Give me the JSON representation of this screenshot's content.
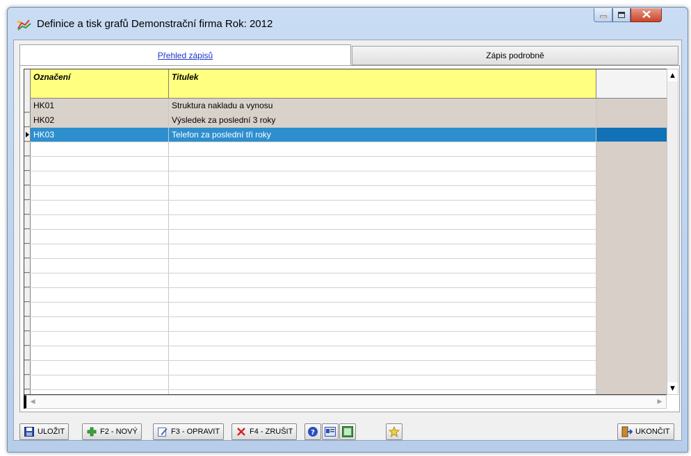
{
  "window": {
    "title": "Definice a tisk grafů  Demonstrační firma  Rok: 2012"
  },
  "tabs": [
    {
      "label": "Přehled zápisů",
      "active": true
    },
    {
      "label": "Zápis podrobně",
      "active": false
    }
  ],
  "grid": {
    "columns": [
      "Označení",
      "Titulek"
    ],
    "rows": [
      {
        "code": "HK01",
        "title": "Struktura nakladu a vynosu",
        "selected": false
      },
      {
        "code": "HK02",
        "title": "Výsledek za poslední 3 roky",
        "selected": false
      },
      {
        "code": "HK03",
        "title": "Telefon za poslední tři roky",
        "selected": true
      }
    ]
  },
  "toolbar": {
    "save": "ULOŽIT",
    "new": "F2 - NOVÝ",
    "edit": "F3 - OPRAVIT",
    "delete": "F4 - ZRUŠIT",
    "exit": "UKONČIT"
  },
  "colors": {
    "header_bg": "#ffff80",
    "selected_row": "#2e8fcf",
    "data_row": "#d9d2cb"
  }
}
